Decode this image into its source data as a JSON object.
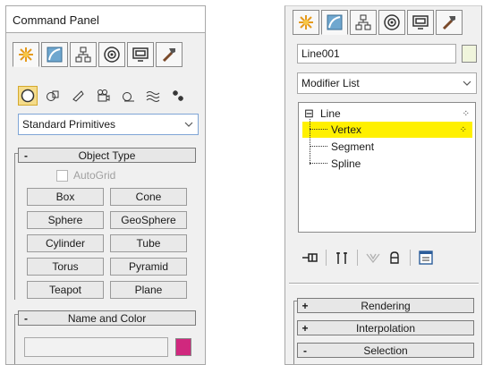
{
  "colors": {
    "accent_yellow": "#fff000",
    "swatch_magenta": "#d0287e",
    "name_swatch_right": "#f0f5dc",
    "active_tool_bg": "#f5dc8b"
  },
  "left": {
    "title": "Command Panel",
    "tabs": [
      "create-icon",
      "modify-icon",
      "hierarchy-icon",
      "motion-icon",
      "display-icon",
      "utilities-icon"
    ],
    "sub_icons": [
      "geometry-icon",
      "shapes-icon",
      "lights-icon",
      "cameras-icon",
      "helpers-icon",
      "spacewarps-icon",
      "systems-icon"
    ],
    "category_dropdown": "Standard Primitives",
    "object_type": {
      "sign": "-",
      "title": "Object Type",
      "autogrid_label": "AutoGrid",
      "buttons": [
        "Box",
        "Cone",
        "Sphere",
        "GeoSphere",
        "Cylinder",
        "Tube",
        "Torus",
        "Pyramid",
        "Teapot",
        "Plane"
      ]
    },
    "name_color": {
      "sign": "-",
      "title": "Name and Color",
      "name_value": ""
    }
  },
  "right": {
    "tabs": [
      "create-icon",
      "modify-icon",
      "hierarchy-icon",
      "motion-icon",
      "display-icon",
      "utilities-icon"
    ],
    "object_name": "Line001",
    "modifier_list": "Modifier List",
    "stack": {
      "root": {
        "sign": "⊟",
        "label": "Line"
      },
      "items": [
        {
          "label": "Vertex",
          "selected": true
        },
        {
          "label": "Segment",
          "selected": false
        },
        {
          "label": "Spline",
          "selected": false
        }
      ]
    },
    "tools": [
      "pin-stack-icon",
      "show-end-result-icon",
      "make-unique-icon",
      "remove-modifier-icon",
      "configure-modifier-sets-icon"
    ],
    "rollouts": [
      {
        "sign": "+",
        "title": "Rendering"
      },
      {
        "sign": "+",
        "title": "Interpolation"
      },
      {
        "sign": "-",
        "title": "Selection"
      }
    ]
  }
}
